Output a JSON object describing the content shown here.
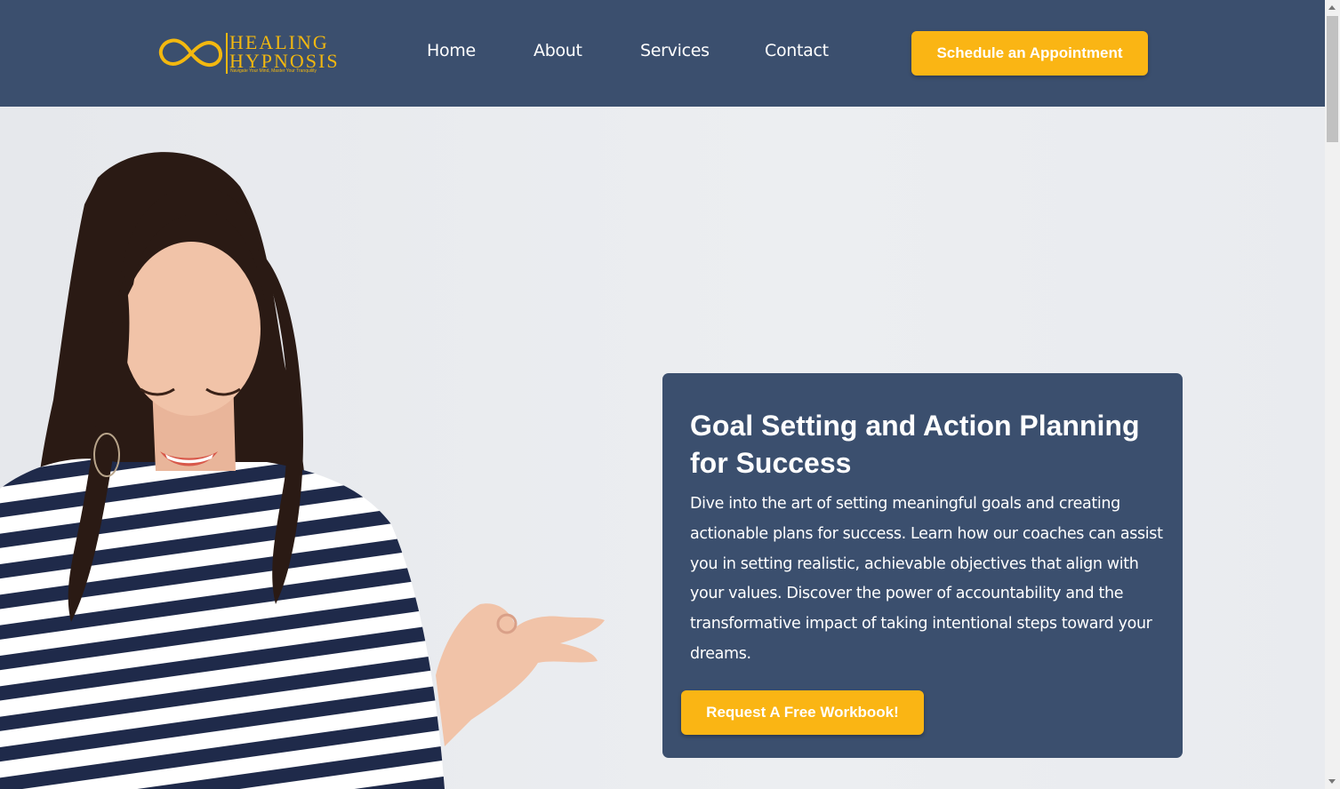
{
  "brand": {
    "name_line1": "HEALING",
    "name_line2": "HYPNOSIS",
    "tagline": "Navigate Your Mind, Master Your Tranquility",
    "color": "#f3b80f"
  },
  "nav": {
    "items": [
      {
        "label": "Home"
      },
      {
        "label": "About"
      },
      {
        "label": "Services"
      },
      {
        "label": "Contact"
      }
    ],
    "cta_label": "Schedule an Appointment"
  },
  "hero": {
    "image_icon": "woman-meditating-image",
    "card": {
      "title": "Goal Setting and Action Planning for Success",
      "body": "Dive into the art of setting meaningful goals and creating actionable plans for success. Learn how our coaches can assist you in setting realistic, achievable objectives that align with your values. Discover the power of accountability and the transformative impact of taking intentional steps toward your dreams.",
      "button_label": "Request A Free Workbook!"
    }
  },
  "colors": {
    "header_bg": "#3b4f6e",
    "accent": "#fab514",
    "card_bg": "#3b4f6e"
  }
}
